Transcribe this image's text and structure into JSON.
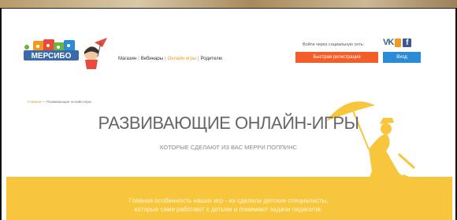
{
  "header": {
    "logo_text": "МЕРСИБО",
    "nav": [
      {
        "label": "Магазин",
        "active": false
      },
      {
        "label": "Вебинары",
        "active": false
      },
      {
        "label": "Онлайн игры",
        "active": true
      },
      {
        "label": "Родителю",
        "active": false
      }
    ],
    "social_label": "Войти через социальную сеть:",
    "register_label": "Быстрая регистрация",
    "login_label": "Вход"
  },
  "icons": [
    "vk-icon",
    "ok-icon",
    "facebook-icon"
  ],
  "breadcrumb": {
    "home": "Главная",
    "sep": " — ",
    "current": "Развивающие онлайн-игры"
  },
  "hero": {
    "title": "РАЗВИВАЮЩИЕ ОНЛАЙН-ИГРЫ",
    "subtitle": "КОТОРЫЕ СДЕЛАЮТ ИЗ ВАС МЕРРИ ПОППИНС"
  },
  "band": {
    "line1": "Главная особенность наших игр - их сделали детские специалисты,",
    "line2": "которые сами работают с детьми и понимают задачи педагогов."
  },
  "colors": {
    "accent": "#f39a1e",
    "register": "#f25d2a",
    "login": "#2a8bd6",
    "band": "#f7c63c"
  }
}
